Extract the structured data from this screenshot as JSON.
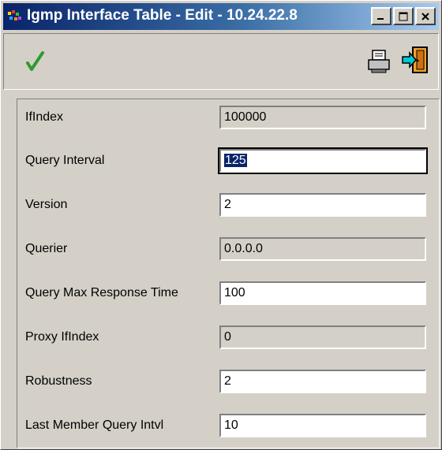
{
  "window": {
    "title": "Igmp Interface Table - Edit - 10.24.22.8"
  },
  "toolbar": {
    "apply": "apply-icon",
    "print": "print-icon",
    "exit": "exit-icon"
  },
  "fields": [
    {
      "label": "IfIndex",
      "value": "100000",
      "editable": false
    },
    {
      "label": "Query Interval",
      "value": "125",
      "editable": true,
      "focused": true
    },
    {
      "label": "Version",
      "value": "2",
      "editable": true
    },
    {
      "label": "Querier",
      "value": "0.0.0.0",
      "editable": false
    },
    {
      "label": "Query Max Response Time",
      "value": "100",
      "editable": true
    },
    {
      "label": "Proxy IfIndex",
      "value": "0",
      "editable": false
    },
    {
      "label": "Robustness",
      "value": "2",
      "editable": true
    },
    {
      "label": "Last Member Query Intvl",
      "value": "10",
      "editable": true
    }
  ],
  "colors": {
    "titlebar_start": "#0a246a",
    "titlebar_end": "#a6caf0",
    "face": "#d4d0c8",
    "check": "#2e9b2e"
  }
}
